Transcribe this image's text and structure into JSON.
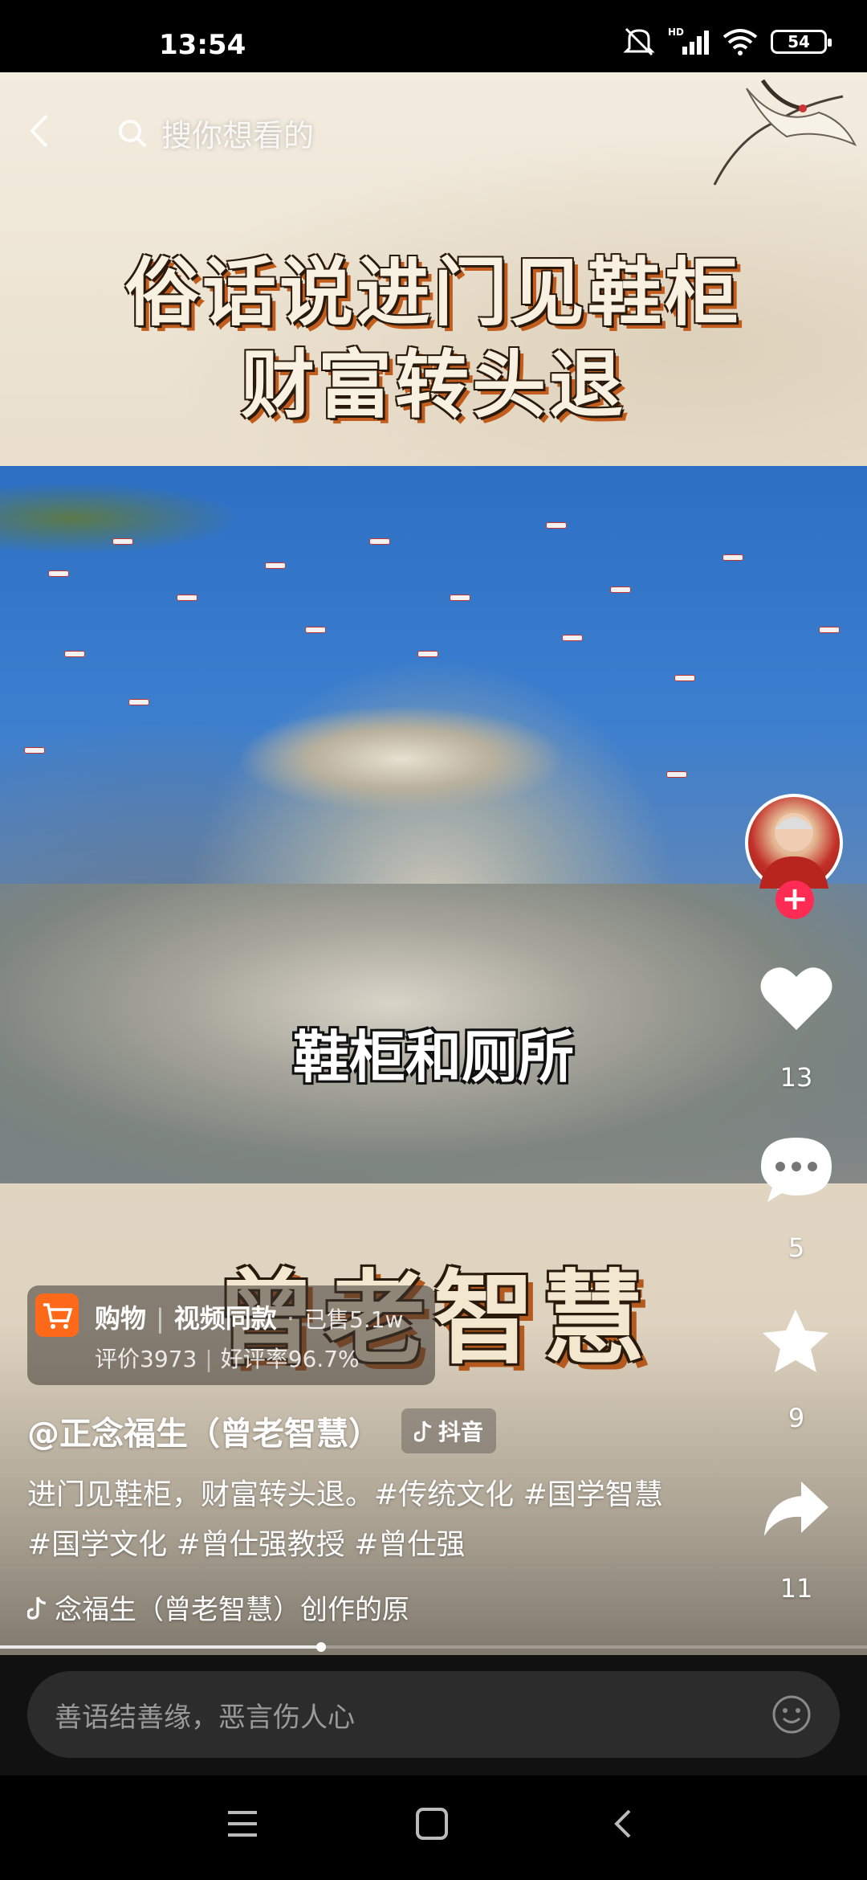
{
  "status_bar": {
    "time": "13:54",
    "battery": "54"
  },
  "search": {
    "placeholder": "搜你想看的"
  },
  "video": {
    "title_line1": "俗话说进门见鞋柜",
    "title_line2": "财富转头退",
    "subtitle": "鞋柜和厕所",
    "bottom_title": "曾老智慧"
  },
  "actions": {
    "likes": "13",
    "comments": "5",
    "favorites": "9",
    "shares": "11"
  },
  "shop": {
    "label": "购物",
    "product": "视频同款",
    "sold": "已售5.1w",
    "reviews": "评价3973",
    "rating": "好评率96.7%"
  },
  "author": {
    "handle": "@正念福生（曾老智慧）",
    "tag": "抖音"
  },
  "description": "进门见鞋柜，财富转头退。#传统文化 #国学智慧 #国学文化 #曾仕强教授 #曾仕强",
  "music": "念福生（曾老智慧）创作的原",
  "comment": {
    "placeholder": "善语结善缘，恶言伤人心"
  },
  "progress": {
    "played_fraction": 0.37
  },
  "icons": [
    "back-icon",
    "search-icon",
    "follow-plus-icon",
    "heart-icon",
    "comment-icon",
    "star-icon",
    "share-icon",
    "cart-icon",
    "music-note-icon",
    "emoji-icon",
    "menu-icon",
    "home-icon",
    "back-nav-icon"
  ],
  "colors": {
    "accent": "#fe2c55",
    "shop": "#ff6a1a"
  }
}
